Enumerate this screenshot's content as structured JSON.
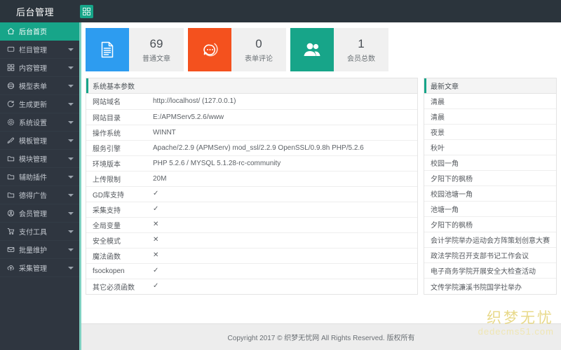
{
  "topbar": {
    "title": "后台管理",
    "badge_icon": "apps-grid-icon"
  },
  "sidebar": {
    "items": [
      {
        "label": "后台首页",
        "icon": "home-icon",
        "active": true,
        "caret": false
      },
      {
        "label": "栏目管理",
        "icon": "monitor-icon",
        "active": false,
        "caret": true
      },
      {
        "label": "内容管理",
        "icon": "grid-icon",
        "active": false,
        "caret": true
      },
      {
        "label": "模型表单",
        "icon": "disc-icon",
        "active": false,
        "caret": true
      },
      {
        "label": "生成更新",
        "icon": "refresh-icon",
        "active": false,
        "caret": true
      },
      {
        "label": "系统设置",
        "icon": "gear-icon",
        "active": false,
        "caret": true
      },
      {
        "label": "模板管理",
        "icon": "brush-icon",
        "active": false,
        "caret": true
      },
      {
        "label": "模块管理",
        "icon": "folder-icon",
        "active": false,
        "caret": true
      },
      {
        "label": "辅助插件",
        "icon": "folder-icon",
        "active": false,
        "caret": true
      },
      {
        "label": "德得广告",
        "icon": "folder-icon",
        "active": false,
        "caret": true
      },
      {
        "label": "会员管理",
        "icon": "user-circle-icon",
        "active": false,
        "caret": true
      },
      {
        "label": "支付工具",
        "icon": "cart-icon",
        "active": false,
        "caret": true
      },
      {
        "label": "批量维护",
        "icon": "mail-icon",
        "active": false,
        "caret": true
      },
      {
        "label": "采集管理",
        "icon": "cloud-up-icon",
        "active": false,
        "caret": true
      }
    ]
  },
  "stats": [
    {
      "value": "69",
      "caption": "普通文章",
      "icon": "document-icon",
      "color": "#2d9cf0"
    },
    {
      "value": "0",
      "caption": "表单评论",
      "icon": "comment-icon",
      "color": "#f4511e"
    },
    {
      "value": "1",
      "caption": "会员总数",
      "icon": "users-icon",
      "color": "#17a589"
    }
  ],
  "system_panel": {
    "title": "系统基本参数",
    "rows": [
      {
        "key": "网站域名",
        "value": "http://localhost/ (127.0.0.1)",
        "type": "text"
      },
      {
        "key": "网站目录",
        "value": "E:/APMServ5.2.6/www",
        "type": "text"
      },
      {
        "key": "操作系统",
        "value": "WINNT",
        "type": "text"
      },
      {
        "key": "服务引擎",
        "value": "Apache/2.2.9 (APMServ) mod_ssl/2.2.9 OpenSSL/0.9.8h PHP/5.2.6",
        "type": "text"
      },
      {
        "key": "环境版本",
        "value": "PHP 5.2.6 / MYSQL 5.1.28-rc-community",
        "type": "text"
      },
      {
        "key": "上传限制",
        "value": "20M",
        "type": "text"
      },
      {
        "key": "GD库支持",
        "value": "✓",
        "type": "yes"
      },
      {
        "key": "采集支持",
        "value": "✓",
        "type": "yes"
      },
      {
        "key": "全局变量",
        "value": "✕",
        "type": "no"
      },
      {
        "key": "安全模式",
        "value": "✕",
        "type": "no"
      },
      {
        "key": "魔法函数",
        "value": "✕",
        "type": "no"
      },
      {
        "key": "fsockopen",
        "value": "✓",
        "type": "yes"
      },
      {
        "key": "其它必须函数",
        "value": "✓",
        "type": "yes"
      }
    ]
  },
  "articles_panel": {
    "title": "最新文章",
    "items": [
      "清晨",
      "清晨",
      "夜景",
      "秋叶",
      "校园一角",
      "夕阳下的枫杨",
      "校园池塘一角",
      "池塘一角",
      "夕阳下的枫杨",
      "会计学院举办运动会方阵策划创意大赛",
      "政法学院召开支部书记工作会议",
      "电子商务学院开展安全大检查活动",
      "文传学院濂溪书院国学社举办"
    ]
  },
  "footer": {
    "text": "Copyright 2017 © 织梦无忧网 All Rights Reserved. 版权所有"
  },
  "watermark": {
    "cn": "织梦无忧",
    "en": "dedecms51.com"
  }
}
